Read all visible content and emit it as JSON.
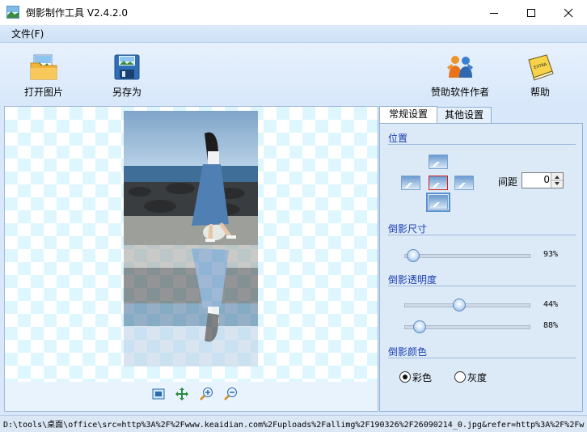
{
  "window": {
    "title": "倒影制作工具 V2.4.2.0"
  },
  "menu": {
    "file": "文件(F)"
  },
  "toolbar": {
    "open": "打开图片",
    "save_as": "另存为",
    "sponsor": "赞助软件作者",
    "help": "帮助"
  },
  "tabs": {
    "general": "常规设置",
    "other": "其他设置"
  },
  "position": {
    "title": "位置",
    "gap_label": "间距",
    "gap_value": "0"
  },
  "reflection_size": {
    "title": "倒影尺寸",
    "value": 93,
    "label": "93%"
  },
  "reflection_opacity": {
    "title": "倒影透明度",
    "start_value": 44,
    "start_label": "44%",
    "end_value": 88,
    "end_label": "88%"
  },
  "reflection_color": {
    "title": "倒影颜色",
    "color_option": "彩色",
    "gray_option": "灰度",
    "selected": "彩色"
  },
  "status": {
    "path": "D:\\tools\\桌面\\office\\src=http%3A%2F%2Fwww.keaidian.com%2Fuploads%2Fallimg%2F190326%2F26090214_0.jpg&refer=http%3A%2F%2Fw"
  },
  "colors": {
    "accent": "#1a3fae",
    "toolbar_bg": "#dceaf8",
    "checker": "#def6fd"
  }
}
